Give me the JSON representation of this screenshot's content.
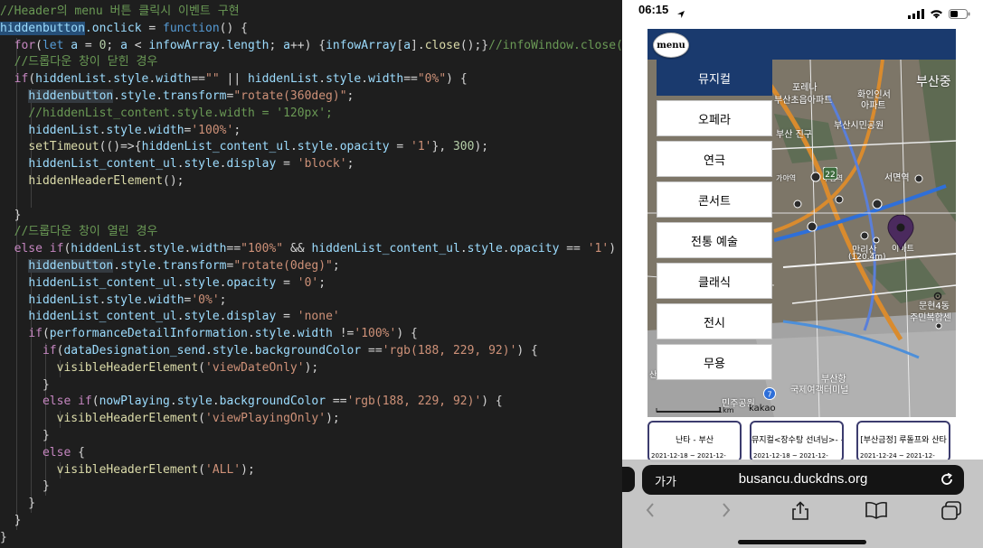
{
  "editor": {
    "lines": [
      {
        "i": [],
        "t": [
          [
            "c",
            "//Header의 menu 버튼 클릭시 이벤트 구현"
          ]
        ]
      },
      {
        "i": [],
        "t": [
          [
            "h",
            "hiddenbutton"
          ],
          [
            "v",
            ".onclick"
          ],
          [
            "p",
            " = "
          ],
          [
            "d",
            "function"
          ],
          [
            "p",
            "() {"
          ]
        ]
      },
      {
        "i": [
          16
        ],
        "t": [
          [
            "p",
            "  "
          ],
          [
            "k",
            "for"
          ],
          [
            "p",
            "("
          ],
          [
            "d",
            "let"
          ],
          [
            "p",
            " "
          ],
          [
            "v",
            "a"
          ],
          [
            "p",
            " = "
          ],
          [
            "n",
            "0"
          ],
          [
            "p",
            "; "
          ],
          [
            "v",
            "a"
          ],
          [
            "p",
            " < "
          ],
          [
            "v",
            "infowArray"
          ],
          [
            "p",
            "."
          ],
          [
            "v",
            "length"
          ],
          [
            "p",
            "; "
          ],
          [
            "v",
            "a"
          ],
          [
            "p",
            "++) {"
          ],
          [
            "v",
            "infowArray"
          ],
          [
            "p",
            "["
          ],
          [
            "v",
            "a"
          ],
          [
            "p",
            "]."
          ],
          [
            "f",
            "close"
          ],
          [
            "p",
            "();}"
          ],
          [
            "c",
            "//infoWindow.close()"
          ]
        ]
      },
      {
        "i": [
          16
        ],
        "t": [
          [
            "p",
            "  "
          ],
          [
            "c",
            "//드롭다운 창이 닫힌 경우"
          ]
        ]
      },
      {
        "i": [
          16
        ],
        "t": [
          [
            "p",
            "  "
          ],
          [
            "k",
            "if"
          ],
          [
            "p",
            "("
          ],
          [
            "v",
            "hiddenList"
          ],
          [
            "p",
            "."
          ],
          [
            "v",
            "style"
          ],
          [
            "p",
            "."
          ],
          [
            "v",
            "width"
          ],
          [
            "p",
            "=="
          ],
          [
            "s",
            "\"\""
          ],
          [
            "p",
            " || "
          ],
          [
            "v",
            "hiddenList"
          ],
          [
            "p",
            "."
          ],
          [
            "v",
            "style"
          ],
          [
            "p",
            "."
          ],
          [
            "v",
            "width"
          ],
          [
            "p",
            "=="
          ],
          [
            "s",
            "\"0%\""
          ],
          [
            "p",
            ") {"
          ]
        ]
      },
      {
        "i": [
          16,
          32
        ],
        "t": [
          [
            "p",
            "    "
          ],
          [
            "g",
            "hiddenbutton"
          ],
          [
            "p",
            "."
          ],
          [
            "v",
            "style"
          ],
          [
            "p",
            "."
          ],
          [
            "v",
            "transform"
          ],
          [
            "p",
            "="
          ],
          [
            "s",
            "\"rotate(360deg)\""
          ],
          [
            "p",
            ";"
          ]
        ]
      },
      {
        "i": [
          16,
          32
        ],
        "t": [
          [
            "p",
            "    "
          ],
          [
            "c",
            "//hiddenList_content.style.width = '120px';"
          ]
        ]
      },
      {
        "i": [
          16,
          32
        ],
        "t": [
          [
            "p",
            "    "
          ],
          [
            "v",
            "hiddenList"
          ],
          [
            "p",
            "."
          ],
          [
            "v",
            "style"
          ],
          [
            "p",
            "."
          ],
          [
            "v",
            "width"
          ],
          [
            "p",
            "="
          ],
          [
            "s",
            "'100%'"
          ],
          [
            "p",
            ";"
          ]
        ]
      },
      {
        "i": [
          16,
          32
        ],
        "t": [
          [
            "p",
            "    "
          ],
          [
            "f",
            "setTimeout"
          ],
          [
            "p",
            "(()=>{"
          ],
          [
            "v",
            "hiddenList_content_ul"
          ],
          [
            "p",
            "."
          ],
          [
            "v",
            "style"
          ],
          [
            "p",
            "."
          ],
          [
            "v",
            "opacity"
          ],
          [
            "p",
            " = "
          ],
          [
            "s",
            "'1'"
          ],
          [
            "p",
            "}, "
          ],
          [
            "n",
            "300"
          ],
          [
            "p",
            ");"
          ]
        ]
      },
      {
        "i": [
          16,
          32
        ],
        "t": [
          [
            "p",
            "    "
          ],
          [
            "v",
            "hiddenList_content_ul"
          ],
          [
            "p",
            "."
          ],
          [
            "v",
            "style"
          ],
          [
            "p",
            "."
          ],
          [
            "v",
            "display"
          ],
          [
            "p",
            " = "
          ],
          [
            "s",
            "'block'"
          ],
          [
            "p",
            ";"
          ]
        ]
      },
      {
        "i": [
          16,
          32
        ],
        "t": [
          [
            "p",
            "    "
          ],
          [
            "f",
            "hiddenHeaderElement"
          ],
          [
            "p",
            "();"
          ]
        ]
      },
      {
        "i": [
          16,
          32
        ],
        "t": []
      },
      {
        "i": [
          16
        ],
        "t": [
          [
            "p",
            "  }"
          ]
        ]
      },
      {
        "i": [
          16
        ],
        "t": [
          [
            "p",
            "  "
          ],
          [
            "c",
            "//드롭다운 창이 열린 경우"
          ]
        ]
      },
      {
        "i": [
          16
        ],
        "t": [
          [
            "p",
            "  "
          ],
          [
            "k",
            "else"
          ],
          [
            "p",
            " "
          ],
          [
            "k",
            "if"
          ],
          [
            "p",
            "("
          ],
          [
            "v",
            "hiddenList"
          ],
          [
            "p",
            "."
          ],
          [
            "v",
            "style"
          ],
          [
            "p",
            "."
          ],
          [
            "v",
            "width"
          ],
          [
            "p",
            "=="
          ],
          [
            "s",
            "\"100%\""
          ],
          [
            "p",
            " && "
          ],
          [
            "v",
            "hiddenList_content_ul"
          ],
          [
            "p",
            "."
          ],
          [
            "v",
            "style"
          ],
          [
            "p",
            "."
          ],
          [
            "v",
            "opacity"
          ],
          [
            "p",
            " == "
          ],
          [
            "s",
            "'1'"
          ],
          [
            "p",
            ") {"
          ]
        ]
      },
      {
        "i": [
          16,
          32
        ],
        "t": [
          [
            "p",
            "    "
          ],
          [
            "g",
            "hiddenbutton"
          ],
          [
            "p",
            "."
          ],
          [
            "v",
            "style"
          ],
          [
            "p",
            "."
          ],
          [
            "v",
            "transform"
          ],
          [
            "p",
            "="
          ],
          [
            "s",
            "\"rotate(0deg)\""
          ],
          [
            "p",
            ";"
          ]
        ]
      },
      {
        "i": [
          16,
          32
        ],
        "t": [
          [
            "p",
            "    "
          ],
          [
            "v",
            "hiddenList_content_ul"
          ],
          [
            "p",
            "."
          ],
          [
            "v",
            "style"
          ],
          [
            "p",
            "."
          ],
          [
            "v",
            "opacity"
          ],
          [
            "p",
            " = "
          ],
          [
            "s",
            "'0'"
          ],
          [
            "p",
            ";"
          ]
        ]
      },
      {
        "i": [
          16,
          32
        ],
        "t": [
          [
            "p",
            "    "
          ],
          [
            "v",
            "hiddenList"
          ],
          [
            "p",
            "."
          ],
          [
            "v",
            "style"
          ],
          [
            "p",
            "."
          ],
          [
            "v",
            "width"
          ],
          [
            "p",
            "="
          ],
          [
            "s",
            "'0%'"
          ],
          [
            "p",
            ";"
          ]
        ]
      },
      {
        "i": [
          16,
          32
        ],
        "t": [
          [
            "p",
            "    "
          ],
          [
            "v",
            "hiddenList_content_ul"
          ],
          [
            "p",
            "."
          ],
          [
            "v",
            "style"
          ],
          [
            "p",
            "."
          ],
          [
            "v",
            "display"
          ],
          [
            "p",
            " = "
          ],
          [
            "s",
            "'none'"
          ]
        ]
      },
      {
        "i": [
          16,
          32
        ],
        "t": [
          [
            "p",
            "    "
          ],
          [
            "k",
            "if"
          ],
          [
            "p",
            "("
          ],
          [
            "v",
            "performanceDetailInformation"
          ],
          [
            "p",
            "."
          ],
          [
            "v",
            "style"
          ],
          [
            "p",
            "."
          ],
          [
            "v",
            "width"
          ],
          [
            "p",
            " !="
          ],
          [
            "s",
            "'100%'"
          ],
          [
            "p",
            ") {"
          ]
        ]
      },
      {
        "i": [
          16,
          32,
          48
        ],
        "t": [
          [
            "p",
            "      "
          ],
          [
            "k",
            "if"
          ],
          [
            "p",
            "("
          ],
          [
            "v",
            "dataDesignation_send"
          ],
          [
            "p",
            "."
          ],
          [
            "v",
            "style"
          ],
          [
            "p",
            "."
          ],
          [
            "v",
            "backgroundColor"
          ],
          [
            "p",
            " =="
          ],
          [
            "s",
            "'rgb(188, 229, 92)'"
          ],
          [
            "p",
            ") {"
          ]
        ]
      },
      {
        "i": [
          16,
          32,
          48,
          64
        ],
        "t": [
          [
            "p",
            "        "
          ],
          [
            "f",
            "visibleHeaderElement"
          ],
          [
            "p",
            "("
          ],
          [
            "s",
            "'viewDateOnly'"
          ],
          [
            "p",
            ");"
          ]
        ]
      },
      {
        "i": [
          16,
          32,
          48
        ],
        "t": [
          [
            "p",
            "      }"
          ]
        ]
      },
      {
        "i": [
          16,
          32,
          48
        ],
        "t": [
          [
            "p",
            "      "
          ],
          [
            "k",
            "else"
          ],
          [
            "p",
            " "
          ],
          [
            "k",
            "if"
          ],
          [
            "p",
            "("
          ],
          [
            "v",
            "nowPlaying"
          ],
          [
            "p",
            "."
          ],
          [
            "v",
            "style"
          ],
          [
            "p",
            "."
          ],
          [
            "v",
            "backgroundColor"
          ],
          [
            "p",
            " =="
          ],
          [
            "s",
            "'rgb(188, 229, 92)'"
          ],
          [
            "p",
            ") {"
          ]
        ]
      },
      {
        "i": [
          16,
          32,
          48,
          64
        ],
        "t": [
          [
            "p",
            "        "
          ],
          [
            "f",
            "visibleHeaderElement"
          ],
          [
            "p",
            "("
          ],
          [
            "s",
            "'viewPlayingOnly'"
          ],
          [
            "p",
            ");"
          ]
        ]
      },
      {
        "i": [
          16,
          32,
          48
        ],
        "t": [
          [
            "p",
            "      }"
          ]
        ]
      },
      {
        "i": [
          16,
          32,
          48
        ],
        "t": [
          [
            "p",
            "      "
          ],
          [
            "k",
            "else"
          ],
          [
            "p",
            " {"
          ]
        ]
      },
      {
        "i": [
          16,
          32,
          48,
          64
        ],
        "t": [
          [
            "p",
            "        "
          ],
          [
            "f",
            "visibleHeaderElement"
          ],
          [
            "p",
            "("
          ],
          [
            "s",
            "'ALL'"
          ],
          [
            "p",
            ");"
          ]
        ]
      },
      {
        "i": [
          16,
          32,
          48
        ],
        "t": [
          [
            "p",
            "      }"
          ]
        ]
      },
      {
        "i": [
          16,
          32
        ],
        "t": [
          [
            "p",
            "    }"
          ]
        ]
      },
      {
        "i": [
          16
        ],
        "t": [
          [
            "p",
            "  }"
          ]
        ]
      },
      {
        "i": [],
        "t": [
          [
            "p",
            "}"
          ]
        ]
      }
    ]
  },
  "phone": {
    "status": {
      "time": "06:15"
    },
    "header": {
      "menu_label": "menu"
    },
    "menu_items": [
      "뮤지컬",
      "오페라",
      "연극",
      "콘서트",
      "전통 예술",
      "클래식",
      "전시",
      "무용"
    ],
    "active_menu_index": 0,
    "map": {
      "labels": [
        {
          "text": "부산중",
          "size": 14
        },
        {
          "text": "포레나",
          "size": 10
        },
        {
          "text": "부산초읍아파트",
          "size": 10
        },
        {
          "text": "화인인서",
          "size": 10
        },
        {
          "text": "아파트",
          "size": 10
        },
        {
          "text": "부산시민공원",
          "size": 10
        },
        {
          "text": "부산 진구",
          "size": 10
        },
        {
          "text": "서면역",
          "size": 10
        },
        {
          "text": "가야역",
          "size": 8
        },
        {
          "text": "부암역",
          "size": 8
        },
        {
          "text": "만리산",
          "size": 10
        },
        {
          "text": "(120.4m)",
          "size": 9
        },
        {
          "text": "이마트",
          "size": 9
        },
        {
          "text": "문현4동",
          "size": 10
        },
        {
          "text": "주민복합센",
          "size": 10
        },
        {
          "text": "부산항",
          "size": 10
        },
        {
          "text": "국제여객터미널",
          "size": 10
        },
        {
          "text": "민주공원",
          "size": 10
        },
        {
          "text": "산병원",
          "size": 9
        },
        {
          "text": "1km",
          "size": 8
        },
        {
          "text": "kakao",
          "size": 10
        }
      ],
      "road_numbers": [
        "22",
        "7"
      ]
    },
    "performances": [
      {
        "title": "난타 - 부산",
        "date": "2021-12-18 ~ 2021-12-"
      },
      {
        "title": "뮤지컬<장수탕 선녀님>- 부",
        "date": "2021-12-18 ~ 2021-12-"
      },
      {
        "title": "[부산금정] 루돌프와 산타",
        "date": "2021-12-24 ~ 2021-12-"
      }
    ],
    "browser": {
      "aa_label": "가가",
      "url": "busancu.duckdns.org"
    },
    "colors": {
      "header": "#1a3a6e",
      "active_item": "#1a3a6e",
      "map_pin": "#4b2a5e",
      "url_bar": "#141414"
    }
  }
}
